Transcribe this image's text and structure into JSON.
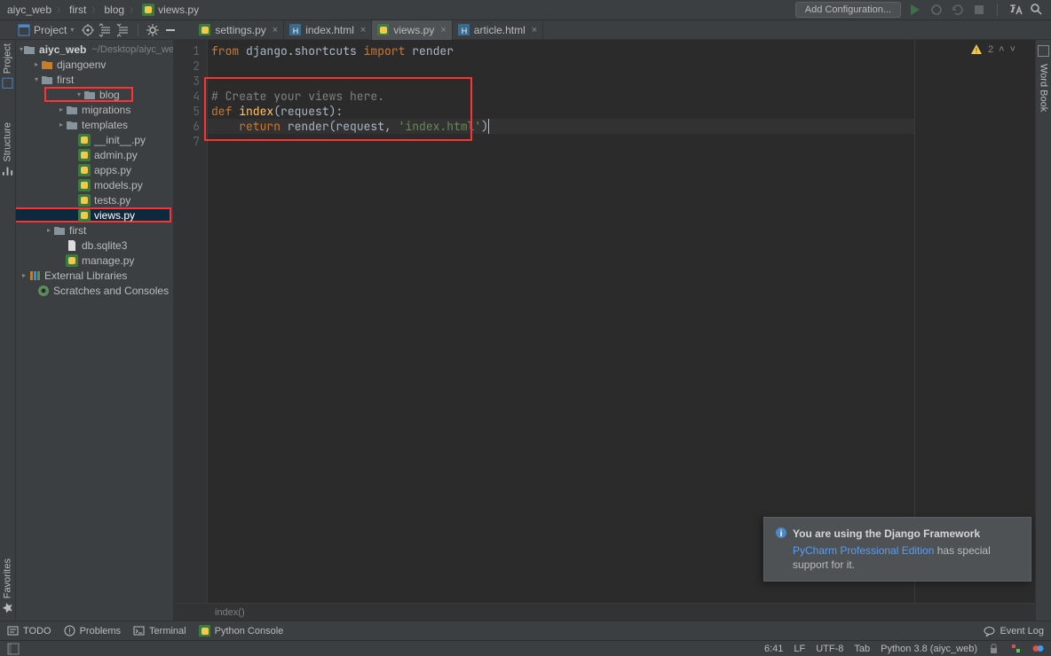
{
  "breadcrumbs": [
    "aiyc_web",
    "first",
    "blog",
    "views.py"
  ],
  "add_config_label": "Add Configuration...",
  "project_button": "Project",
  "tabs": [
    {
      "label": "settings.py",
      "active": false,
      "icon": "py"
    },
    {
      "label": "index.html",
      "active": false,
      "icon": "html"
    },
    {
      "label": "views.py",
      "active": true,
      "icon": "py"
    },
    {
      "label": "article.html",
      "active": false,
      "icon": "html"
    }
  ],
  "left_tabs": {
    "project": "Project",
    "structure": "Structure",
    "favorites": "Favorites"
  },
  "right_tabs": {
    "wordbook": "Word Book"
  },
  "tree": {
    "root": {
      "name": "aiyc_web",
      "hint": "~/Desktop/aiyc_we"
    },
    "djangoenv": "djangoenv",
    "first": "first",
    "blog": "blog",
    "migrations": "migrations",
    "templates": "templates",
    "init": "__init__.py",
    "admin": "admin.py",
    "apps": "apps.py",
    "models": "models.py",
    "tests": "tests.py",
    "views": "views.py",
    "first2": "first",
    "db": "db.sqlite3",
    "manage": "manage.py",
    "ext": "External Libraries",
    "scratch": "Scratches and Consoles"
  },
  "code": {
    "l1_kw1": "from",
    "l1_mod": " django.shortcuts ",
    "l1_kw2": "import",
    "l1_fn": " render",
    "l4": "# Create your views here.",
    "l5_kw": "def ",
    "l5_fn": "index",
    "l5_rest": "(request):",
    "l6_pre": "    ",
    "l6_kw": "return ",
    "l6_call": "render(request, ",
    "l6_str": "'index.html'",
    "l6_end": ")",
    "crumb": "index()"
  },
  "gutter": [
    "1",
    "2",
    "3",
    "4",
    "5",
    "6",
    "7"
  ],
  "inspection_count": "2",
  "notification": {
    "title": "You are using the Django Framework",
    "link": "PyCharm Professional Edition",
    "body_rest": " has special support for it."
  },
  "bottom": {
    "todo": "TODO",
    "problems": "Problems",
    "terminal": "Terminal",
    "pyconsole": "Python Console",
    "eventlog": "Event Log"
  },
  "status": {
    "pos": "6:41",
    "le": "LF",
    "enc": "UTF-8",
    "indent": "Tab",
    "interp": "Python 3.8 (aiyc_web)"
  }
}
